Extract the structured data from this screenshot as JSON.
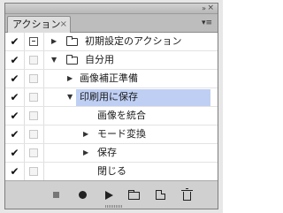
{
  "panel": {
    "tab_label": "アクション",
    "tab_close_glyph": "×",
    "collapse_glyph": "»",
    "close_glyph": "×",
    "menu_glyph": "▾≡"
  },
  "rows": [
    {
      "label": "初期設定のアクション",
      "checked": true,
      "dialog": "on",
      "expand": "collapsed",
      "type": "set"
    },
    {
      "label": "自分用",
      "checked": true,
      "dialog": "off",
      "expand": "expanded",
      "type": "set"
    },
    {
      "label": "画像補正準備",
      "checked": true,
      "dialog": "off",
      "expand": "collapsed",
      "type": "action"
    },
    {
      "label": "印刷用に保存",
      "checked": true,
      "dialog": "off",
      "expand": "expanded",
      "type": "action",
      "selected": true
    },
    {
      "label": "画像を統合",
      "checked": true,
      "dialog": "off",
      "expand": "none",
      "type": "command"
    },
    {
      "label": "モード変換",
      "checked": true,
      "dialog": "off",
      "expand": "collapsed",
      "type": "command"
    },
    {
      "label": "保存",
      "checked": true,
      "dialog": "off",
      "expand": "collapsed",
      "type": "command"
    },
    {
      "label": "閉じる",
      "checked": true,
      "dialog": "off",
      "expand": "none",
      "type": "command"
    }
  ],
  "glyphs": {
    "check": "✔",
    "tri_collapsed": "▶",
    "tri_expanded": "▼"
  },
  "colors": {
    "selection": "#bfcff4",
    "panel_bg": "#c9c9c9"
  },
  "footer": {
    "icons": [
      "stop-icon",
      "record-icon",
      "play-icon",
      "new-set-icon",
      "new-action-icon",
      "trash-icon"
    ]
  }
}
